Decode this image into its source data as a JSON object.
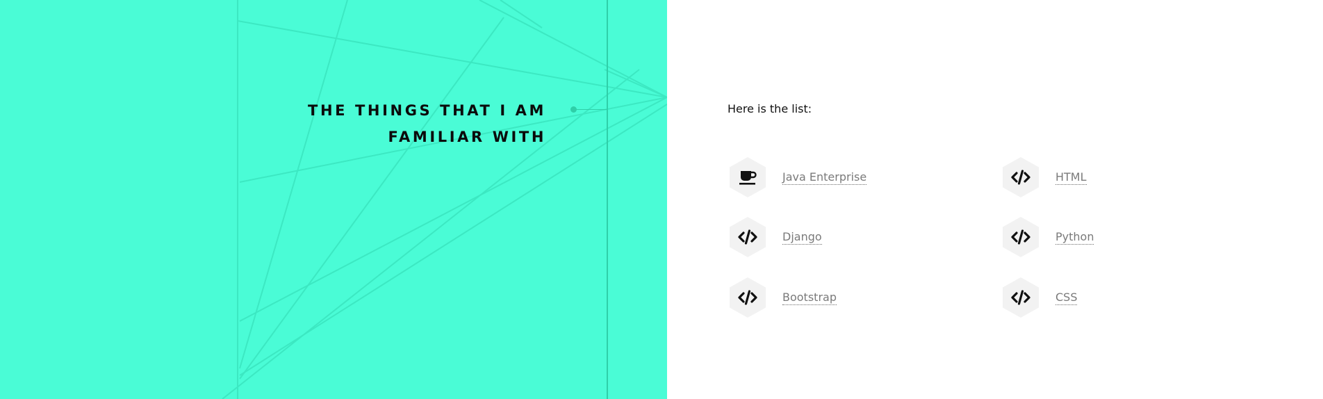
{
  "section": {
    "title_line1": "THE THINGS THAT I AM",
    "title_line2": "FAMILIAR WITH"
  },
  "colors": {
    "accent": "#4afcd6",
    "timeline": "#2fcfa8",
    "hex_bg": "#f2f2f2",
    "link_text": "#7a7a7a"
  },
  "list": {
    "intro": "Here is the list:",
    "skills": [
      {
        "label": "Java Enterprise",
        "icon": "coffee-icon"
      },
      {
        "label": "HTML",
        "icon": "code-icon"
      },
      {
        "label": "Django",
        "icon": "code-icon"
      },
      {
        "label": "Python",
        "icon": "code-icon"
      },
      {
        "label": "Bootstrap",
        "icon": "code-icon"
      },
      {
        "label": "CSS",
        "icon": "code-icon"
      }
    ]
  }
}
